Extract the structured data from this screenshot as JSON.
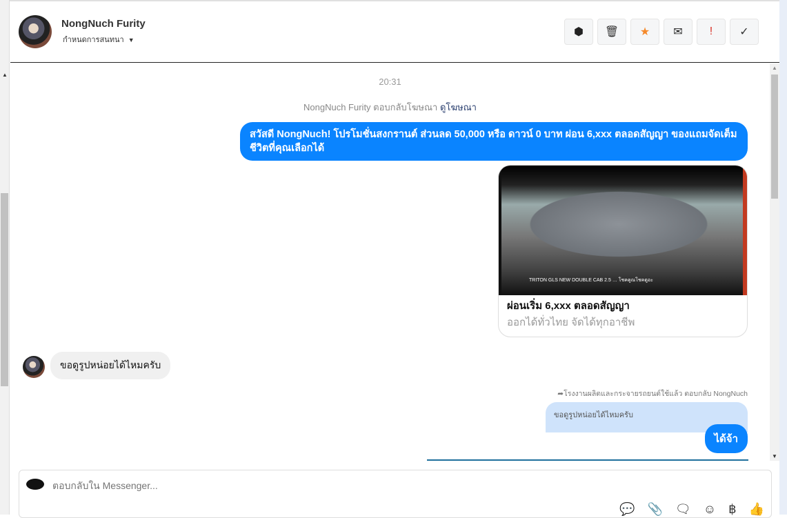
{
  "header": {
    "name": "NongNuch Furity",
    "subtitle": "กำหนดการสนทนา",
    "subtitle_caret": "▼",
    "toolbar": [
      {
        "name": "spam-button",
        "icon": "alert-octagon-icon",
        "glyph": "⬢",
        "color": "#222"
      },
      {
        "name": "delete-button",
        "icon": "trash-icon",
        "glyph": "🗑",
        "color": "#333"
      },
      {
        "name": "star-button",
        "icon": "star-icon",
        "glyph": "★",
        "color": "#f5892a"
      },
      {
        "name": "mark-unread-button",
        "icon": "envelope-icon",
        "glyph": "✉",
        "color": "#222"
      },
      {
        "name": "important-button",
        "icon": "exclamation-icon",
        "glyph": "!",
        "color": "#d93025"
      },
      {
        "name": "done-button",
        "icon": "check-icon",
        "glyph": "✓",
        "color": "#333"
      }
    ]
  },
  "chat": {
    "timestamp": "20:31",
    "reply_info": "NongNuch Furity ตอบกลับโฆษณา",
    "reply_link": "ดูโฆษณา",
    "ad_message": "สวัสดี NongNuch! โปรโมชั่นสงกรานต์ ส่วนลด 50,000 หรือ ดาวน์ 0 บาท ผ่อน 6,xxx ตลอดสัญญา ของแถมจัดเต็ม ชีวิตที่คุณเลือกได้",
    "ad_card": {
      "title": "ผ่อนเริ่ม 6,xxx ตลอดสัญญา",
      "subtitle": "ออกได้ทั่วไทย จัดได้ทุกอาชีพ",
      "image_caption": "TRITON GLS NEW DOUBLE CAB 2.5 … โชคคูณโชคดูอะ"
    },
    "incoming": "ขอดูรูปหน่อยได้ไหมครับ",
    "quote_label": "โรงงานผลิตและกระจายรถยนต์ใช้แล้ว ตอบกลับ NongNuch",
    "quoted_text": "ขอดูรูปหน่อยได้ไหมครับ",
    "reply": "ได้จ้า"
  },
  "composer": {
    "placeholder": "ตอบกลับใน Messenger...",
    "icons": [
      {
        "name": "saved-reply-icon",
        "glyph": "💬"
      },
      {
        "name": "attachment-icon",
        "glyph": "📎"
      },
      {
        "name": "quick-reply-icon",
        "glyph": "🗨"
      },
      {
        "name": "emoji-icon",
        "glyph": "☺"
      },
      {
        "name": "payment-baht-icon",
        "glyph": "฿"
      },
      {
        "name": "like-icon",
        "glyph": "👍"
      }
    ]
  },
  "colors": {
    "accent": "#0a84ff",
    "star": "#f5892a",
    "danger": "#d93025"
  }
}
